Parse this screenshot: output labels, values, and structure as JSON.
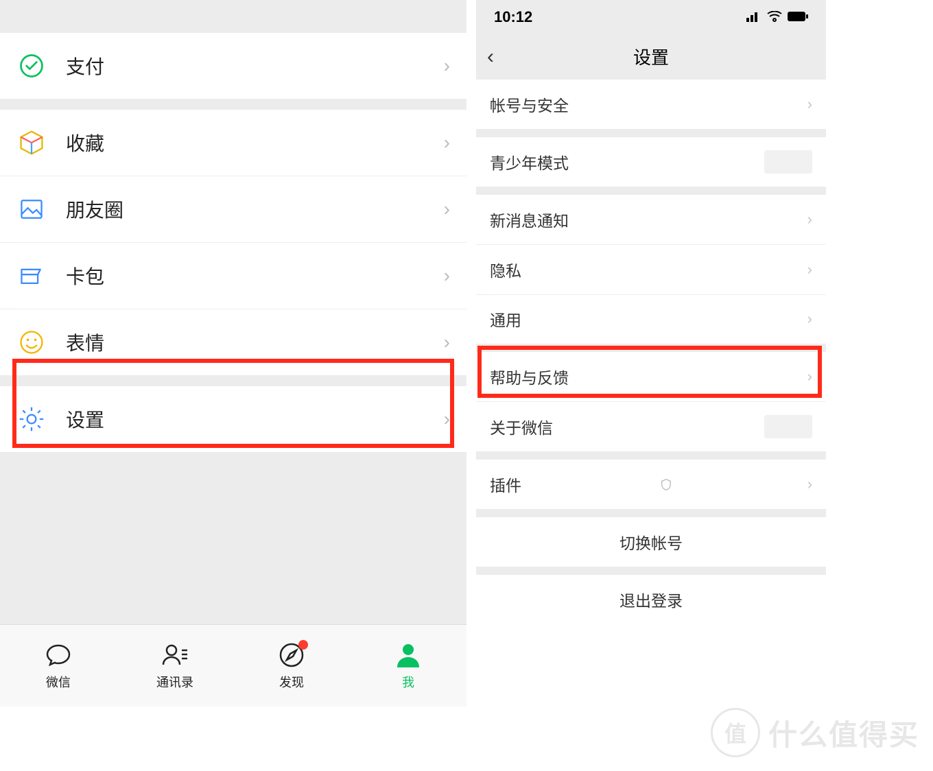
{
  "left": {
    "rows": {
      "pay": {
        "label": "支付"
      },
      "fav": {
        "label": "收藏"
      },
      "moments": {
        "label": "朋友圈"
      },
      "cards": {
        "label": "卡包"
      },
      "stickers": {
        "label": "表情"
      },
      "settings": {
        "label": "设置"
      }
    },
    "tabs": {
      "chat": "微信",
      "contacts": "通讯录",
      "discover": "发现",
      "me": "我"
    }
  },
  "right": {
    "status_time": "10:12",
    "nav_title": "设置",
    "rows": {
      "account": "帐号与安全",
      "youth": "青少年模式",
      "notif": "新消息通知",
      "privacy": "隐私",
      "general": "通用",
      "help": "帮助与反馈",
      "about": "关于微信",
      "plugins": "插件",
      "switch": "切换帐号",
      "logout": "退出登录"
    }
  },
  "watermark": {
    "badge": "值",
    "text": "什么值得买"
  }
}
